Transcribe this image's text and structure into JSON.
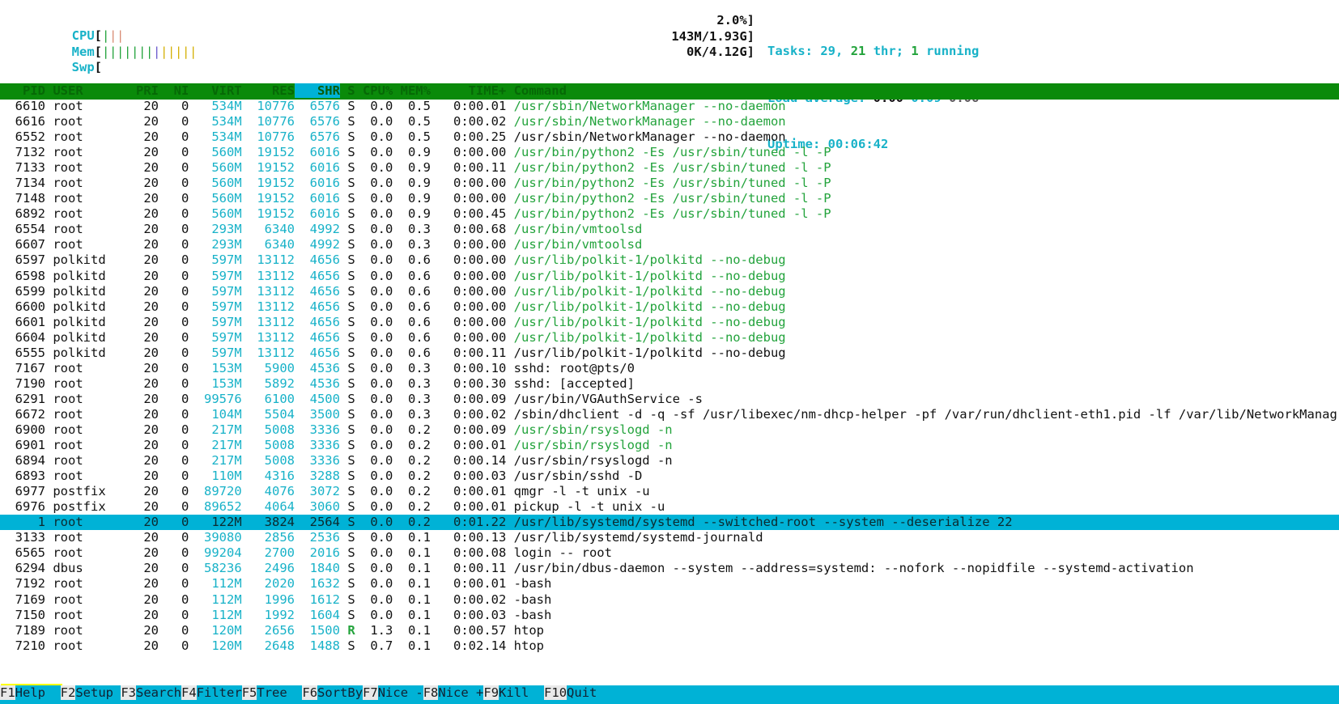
{
  "app": {
    "name": "htop",
    "terminal_title": "htop process viewer"
  },
  "meters": {
    "cpu": {
      "label": "CPU",
      "value": "2.0%",
      "bracket_open": "[",
      "bracket_close": "]",
      "bars": [
        {
          "color": "#23a33c",
          "glyph": "|"
        },
        {
          "color": "#d98b73",
          "glyph": "|"
        },
        {
          "color": "#d98b73",
          "glyph": "|"
        }
      ],
      "total_slots": 52
    },
    "mem": {
      "label": "Mem",
      "value": "143M/1.93G",
      "bracket_open": "[",
      "bracket_close": "]",
      "bars": [
        {
          "color": "#23a33c",
          "glyph": "|"
        },
        {
          "color": "#23a33c",
          "glyph": "|"
        },
        {
          "color": "#23a33c",
          "glyph": "|"
        },
        {
          "color": "#23a33c",
          "glyph": "|"
        },
        {
          "color": "#23a33c",
          "glyph": "|"
        },
        {
          "color": "#23a33c",
          "glyph": "|"
        },
        {
          "color": "#23a33c",
          "glyph": "|"
        },
        {
          "color": "#6a5acd",
          "glyph": "|"
        },
        {
          "color": "#d4b006",
          "glyph": "|"
        },
        {
          "color": "#d4b006",
          "glyph": "|"
        },
        {
          "color": "#d4b006",
          "glyph": "|"
        },
        {
          "color": "#d4b006",
          "glyph": "|"
        },
        {
          "color": "#d4b006",
          "glyph": "|"
        }
      ],
      "total_slots": 52
    },
    "swp": {
      "label": "Swp",
      "value": "0K/4.12G",
      "bracket_open": "[",
      "bracket_close": "]",
      "bars": [],
      "total_slots": 52
    }
  },
  "stats": {
    "tasks_label": "Tasks:",
    "tasks_count": "29,",
    "threads_count": "21",
    "threads_label": "thr;",
    "running_count": "1",
    "running_label": "running",
    "load_label": "Load average:",
    "load_1": "0.00",
    "load_5": "0.09",
    "load_15": "0.06",
    "uptime_label": "Uptime:",
    "uptime_value": "00:06:42"
  },
  "columns": {
    "headers": [
      "PID",
      "USER",
      "PRI",
      "NI",
      "VIRT",
      "RES",
      "SHR",
      "S",
      "CPU%",
      "MEM%",
      "TIME+",
      "Command"
    ],
    "sort_column": "SHR"
  },
  "processes": [
    {
      "pid": "6610",
      "user": "root",
      "pri": "20",
      "ni": "0",
      "virt": "534M",
      "res": "10776",
      "shr": "6576",
      "s": "S",
      "cpu": "0.0",
      "mem": "0.5",
      "time": "0:00.01",
      "command": "/usr/sbin/NetworkManager --no-daemon",
      "cmd_color": "green",
      "selected": false
    },
    {
      "pid": "6616",
      "user": "root",
      "pri": "20",
      "ni": "0",
      "virt": "534M",
      "res": "10776",
      "shr": "6576",
      "s": "S",
      "cpu": "0.0",
      "mem": "0.5",
      "time": "0:00.02",
      "command": "/usr/sbin/NetworkManager --no-daemon",
      "cmd_color": "green",
      "selected": false
    },
    {
      "pid": "6552",
      "user": "root",
      "pri": "20",
      "ni": "0",
      "virt": "534M",
      "res": "10776",
      "shr": "6576",
      "s": "S",
      "cpu": "0.0",
      "mem": "0.5",
      "time": "0:00.25",
      "command": "/usr/sbin/NetworkManager --no-daemon",
      "cmd_color": "black",
      "selected": false
    },
    {
      "pid": "7132",
      "user": "root",
      "pri": "20",
      "ni": "0",
      "virt": "560M",
      "res": "19152",
      "shr": "6016",
      "s": "S",
      "cpu": "0.0",
      "mem": "0.9",
      "time": "0:00.00",
      "command": "/usr/bin/python2 -Es /usr/sbin/tuned -l -P",
      "cmd_color": "green",
      "selected": false
    },
    {
      "pid": "7133",
      "user": "root",
      "pri": "20",
      "ni": "0",
      "virt": "560M",
      "res": "19152",
      "shr": "6016",
      "s": "S",
      "cpu": "0.0",
      "mem": "0.9",
      "time": "0:00.11",
      "command": "/usr/bin/python2 -Es /usr/sbin/tuned -l -P",
      "cmd_color": "green",
      "selected": false
    },
    {
      "pid": "7134",
      "user": "root",
      "pri": "20",
      "ni": "0",
      "virt": "560M",
      "res": "19152",
      "shr": "6016",
      "s": "S",
      "cpu": "0.0",
      "mem": "0.9",
      "time": "0:00.00",
      "command": "/usr/bin/python2 -Es /usr/sbin/tuned -l -P",
      "cmd_color": "green",
      "selected": false
    },
    {
      "pid": "7148",
      "user": "root",
      "pri": "20",
      "ni": "0",
      "virt": "560M",
      "res": "19152",
      "shr": "6016",
      "s": "S",
      "cpu": "0.0",
      "mem": "0.9",
      "time": "0:00.00",
      "command": "/usr/bin/python2 -Es /usr/sbin/tuned -l -P",
      "cmd_color": "green",
      "selected": false
    },
    {
      "pid": "6892",
      "user": "root",
      "pri": "20",
      "ni": "0",
      "virt": "560M",
      "res": "19152",
      "shr": "6016",
      "s": "S",
      "cpu": "0.0",
      "mem": "0.9",
      "time": "0:00.45",
      "command": "/usr/bin/python2 -Es /usr/sbin/tuned -l -P",
      "cmd_color": "green",
      "selected": false
    },
    {
      "pid": "6554",
      "user": "root",
      "pri": "20",
      "ni": "0",
      "virt": "293M",
      "res": "6340",
      "shr": "4992",
      "s": "S",
      "cpu": "0.0",
      "mem": "0.3",
      "time": "0:00.68",
      "command": "/usr/bin/vmtoolsd",
      "cmd_color": "green",
      "selected": false
    },
    {
      "pid": "6607",
      "user": "root",
      "pri": "20",
      "ni": "0",
      "virt": "293M",
      "res": "6340",
      "shr": "4992",
      "s": "S",
      "cpu": "0.0",
      "mem": "0.3",
      "time": "0:00.00",
      "command": "/usr/bin/vmtoolsd",
      "cmd_color": "green",
      "selected": false
    },
    {
      "pid": "6597",
      "user": "polkitd",
      "pri": "20",
      "ni": "0",
      "virt": "597M",
      "res": "13112",
      "shr": "4656",
      "s": "S",
      "cpu": "0.0",
      "mem": "0.6",
      "time": "0:00.00",
      "command": "/usr/lib/polkit-1/polkitd --no-debug",
      "cmd_color": "green",
      "selected": false
    },
    {
      "pid": "6598",
      "user": "polkitd",
      "pri": "20",
      "ni": "0",
      "virt": "597M",
      "res": "13112",
      "shr": "4656",
      "s": "S",
      "cpu": "0.0",
      "mem": "0.6",
      "time": "0:00.00",
      "command": "/usr/lib/polkit-1/polkitd --no-debug",
      "cmd_color": "green",
      "selected": false
    },
    {
      "pid": "6599",
      "user": "polkitd",
      "pri": "20",
      "ni": "0",
      "virt": "597M",
      "res": "13112",
      "shr": "4656",
      "s": "S",
      "cpu": "0.0",
      "mem": "0.6",
      "time": "0:00.00",
      "command": "/usr/lib/polkit-1/polkitd --no-debug",
      "cmd_color": "green",
      "selected": false
    },
    {
      "pid": "6600",
      "user": "polkitd",
      "pri": "20",
      "ni": "0",
      "virt": "597M",
      "res": "13112",
      "shr": "4656",
      "s": "S",
      "cpu": "0.0",
      "mem": "0.6",
      "time": "0:00.00",
      "command": "/usr/lib/polkit-1/polkitd --no-debug",
      "cmd_color": "green",
      "selected": false
    },
    {
      "pid": "6601",
      "user": "polkitd",
      "pri": "20",
      "ni": "0",
      "virt": "597M",
      "res": "13112",
      "shr": "4656",
      "s": "S",
      "cpu": "0.0",
      "mem": "0.6",
      "time": "0:00.00",
      "command": "/usr/lib/polkit-1/polkitd --no-debug",
      "cmd_color": "green",
      "selected": false
    },
    {
      "pid": "6604",
      "user": "polkitd",
      "pri": "20",
      "ni": "0",
      "virt": "597M",
      "res": "13112",
      "shr": "4656",
      "s": "S",
      "cpu": "0.0",
      "mem": "0.6",
      "time": "0:00.00",
      "command": "/usr/lib/polkit-1/polkitd --no-debug",
      "cmd_color": "green",
      "selected": false
    },
    {
      "pid": "6555",
      "user": "polkitd",
      "pri": "20",
      "ni": "0",
      "virt": "597M",
      "res": "13112",
      "shr": "4656",
      "s": "S",
      "cpu": "0.0",
      "mem": "0.6",
      "time": "0:00.11",
      "command": "/usr/lib/polkit-1/polkitd --no-debug",
      "cmd_color": "black",
      "selected": false
    },
    {
      "pid": "7167",
      "user": "root",
      "pri": "20",
      "ni": "0",
      "virt": "153M",
      "res": "5900",
      "shr": "4536",
      "s": "S",
      "cpu": "0.0",
      "mem": "0.3",
      "time": "0:00.10",
      "command": "sshd: root@pts/0",
      "cmd_color": "black",
      "selected": false
    },
    {
      "pid": "7190",
      "user": "root",
      "pri": "20",
      "ni": "0",
      "virt": "153M",
      "res": "5892",
      "shr": "4536",
      "s": "S",
      "cpu": "0.0",
      "mem": "0.3",
      "time": "0:00.30",
      "command": "sshd: [accepted]",
      "cmd_color": "black",
      "selected": false
    },
    {
      "pid": "6291",
      "user": "root",
      "pri": "20",
      "ni": "0",
      "virt": "99576",
      "res": "6100",
      "shr": "4500",
      "s": "S",
      "cpu": "0.0",
      "mem": "0.3",
      "time": "0:00.09",
      "command": "/usr/bin/VGAuthService -s",
      "cmd_color": "black",
      "selected": false
    },
    {
      "pid": "6672",
      "user": "root",
      "pri": "20",
      "ni": "0",
      "virt": "104M",
      "res": "5504",
      "shr": "3500",
      "s": "S",
      "cpu": "0.0",
      "mem": "0.3",
      "time": "0:00.02",
      "command": "/sbin/dhclient -d -q -sf /usr/libexec/nm-dhcp-helper -pf /var/run/dhclient-eth1.pid -lf /var/lib/NetworkManag",
      "cmd_color": "black",
      "selected": false
    },
    {
      "pid": "6900",
      "user": "root",
      "pri": "20",
      "ni": "0",
      "virt": "217M",
      "res": "5008",
      "shr": "3336",
      "s": "S",
      "cpu": "0.0",
      "mem": "0.2",
      "time": "0:00.09",
      "command": "/usr/sbin/rsyslogd -n",
      "cmd_color": "green",
      "selected": false
    },
    {
      "pid": "6901",
      "user": "root",
      "pri": "20",
      "ni": "0",
      "virt": "217M",
      "res": "5008",
      "shr": "3336",
      "s": "S",
      "cpu": "0.0",
      "mem": "0.2",
      "time": "0:00.01",
      "command": "/usr/sbin/rsyslogd -n",
      "cmd_color": "green",
      "selected": false
    },
    {
      "pid": "6894",
      "user": "root",
      "pri": "20",
      "ni": "0",
      "virt": "217M",
      "res": "5008",
      "shr": "3336",
      "s": "S",
      "cpu": "0.0",
      "mem": "0.2",
      "time": "0:00.14",
      "command": "/usr/sbin/rsyslogd -n",
      "cmd_color": "black",
      "selected": false
    },
    {
      "pid": "6893",
      "user": "root",
      "pri": "20",
      "ni": "0",
      "virt": "110M",
      "res": "4316",
      "shr": "3288",
      "s": "S",
      "cpu": "0.0",
      "mem": "0.2",
      "time": "0:00.03",
      "command": "/usr/sbin/sshd -D",
      "cmd_color": "black",
      "selected": false
    },
    {
      "pid": "6977",
      "user": "postfix",
      "pri": "20",
      "ni": "0",
      "virt": "89720",
      "res": "4076",
      "shr": "3072",
      "s": "S",
      "cpu": "0.0",
      "mem": "0.2",
      "time": "0:00.01",
      "command": "qmgr -l -t unix -u",
      "cmd_color": "black",
      "selected": false
    },
    {
      "pid": "6976",
      "user": "postfix",
      "pri": "20",
      "ni": "0",
      "virt": "89652",
      "res": "4064",
      "shr": "3060",
      "s": "S",
      "cpu": "0.0",
      "mem": "0.2",
      "time": "0:00.01",
      "command": "pickup -l -t unix -u",
      "cmd_color": "black",
      "selected": false
    },
    {
      "pid": "1",
      "user": "root",
      "pri": "20",
      "ni": "0",
      "virt": "122M",
      "res": "3824",
      "shr": "2564",
      "s": "S",
      "cpu": "0.0",
      "mem": "0.2",
      "time": "0:01.22",
      "command": "/usr/lib/systemd/systemd --switched-root --system --deserialize 22",
      "cmd_color": "black",
      "selected": true
    },
    {
      "pid": "3133",
      "user": "root",
      "pri": "20",
      "ni": "0",
      "virt": "39080",
      "res": "2856",
      "shr": "2536",
      "s": "S",
      "cpu": "0.0",
      "mem": "0.1",
      "time": "0:00.13",
      "command": "/usr/lib/systemd/systemd-journald",
      "cmd_color": "black",
      "selected": false
    },
    {
      "pid": "6565",
      "user": "root",
      "pri": "20",
      "ni": "0",
      "virt": "99204",
      "res": "2700",
      "shr": "2016",
      "s": "S",
      "cpu": "0.0",
      "mem": "0.1",
      "time": "0:00.08",
      "command": "login -- root",
      "cmd_color": "black",
      "selected": false
    },
    {
      "pid": "6294",
      "user": "dbus",
      "pri": "20",
      "ni": "0",
      "virt": "58236",
      "res": "2496",
      "shr": "1840",
      "s": "S",
      "cpu": "0.0",
      "mem": "0.1",
      "time": "0:00.11",
      "command": "/usr/bin/dbus-daemon --system --address=systemd: --nofork --nopidfile --systemd-activation",
      "cmd_color": "black",
      "selected": false
    },
    {
      "pid": "7192",
      "user": "root",
      "pri": "20",
      "ni": "0",
      "virt": "112M",
      "res": "2020",
      "shr": "1632",
      "s": "S",
      "cpu": "0.0",
      "mem": "0.1",
      "time": "0:00.01",
      "command": "-bash",
      "cmd_color": "black",
      "selected": false
    },
    {
      "pid": "7169",
      "user": "root",
      "pri": "20",
      "ni": "0",
      "virt": "112M",
      "res": "1996",
      "shr": "1612",
      "s": "S",
      "cpu": "0.0",
      "mem": "0.1",
      "time": "0:00.02",
      "command": "-bash",
      "cmd_color": "black",
      "selected": false
    },
    {
      "pid": "7150",
      "user": "root",
      "pri": "20",
      "ni": "0",
      "virt": "112M",
      "res": "1992",
      "shr": "1604",
      "s": "S",
      "cpu": "0.0",
      "mem": "0.1",
      "time": "0:00.03",
      "command": "-bash",
      "cmd_color": "black",
      "selected": false
    },
    {
      "pid": "7189",
      "user": "root",
      "pri": "20",
      "ni": "0",
      "virt": "120M",
      "res": "2656",
      "shr": "1500",
      "s": "R",
      "cpu": "1.3",
      "mem": "0.1",
      "time": "0:00.57",
      "command": "htop",
      "cmd_color": "black",
      "selected": false
    },
    {
      "pid": "7210",
      "user": "root",
      "pri": "20",
      "ni": "0",
      "virt": "120M",
      "res": "2648",
      "shr": "1488",
      "s": "S",
      "cpu": "0.7",
      "mem": "0.1",
      "time": "0:02.14",
      "command": "htop",
      "cmd_color": "black",
      "selected": false
    }
  ],
  "function_bar": [
    {
      "key": "F1",
      "label": "Help  "
    },
    {
      "key": "F2",
      "label": "Setup "
    },
    {
      "key": "F3",
      "label": "Search"
    },
    {
      "key": "F4",
      "label": "Filter"
    },
    {
      "key": "F5",
      "label": "Tree  "
    },
    {
      "key": "F6",
      "label": "SortBy"
    },
    {
      "key": "F7",
      "label": "Nice -"
    },
    {
      "key": "F8",
      "label": "Nice +"
    },
    {
      "key": "F9",
      "label": "Kill  "
    },
    {
      "key": "F10",
      "label": "Quit"
    }
  ],
  "annotation": {
    "highlight_color": "#ffff00",
    "target": "F1 Help"
  },
  "colors": {
    "accent_cyan": "#00b2d6",
    "header_green": "#0a8a0a",
    "text_cyan": "#18b2c8",
    "text_green": "#23a33c",
    "bar_green": "#23a33c",
    "bar_yellow": "#d4b006",
    "bar_red": "#d98b73",
    "bar_blue": "#6a5acd",
    "background": "#ffffff",
    "foreground": "#111111"
  }
}
